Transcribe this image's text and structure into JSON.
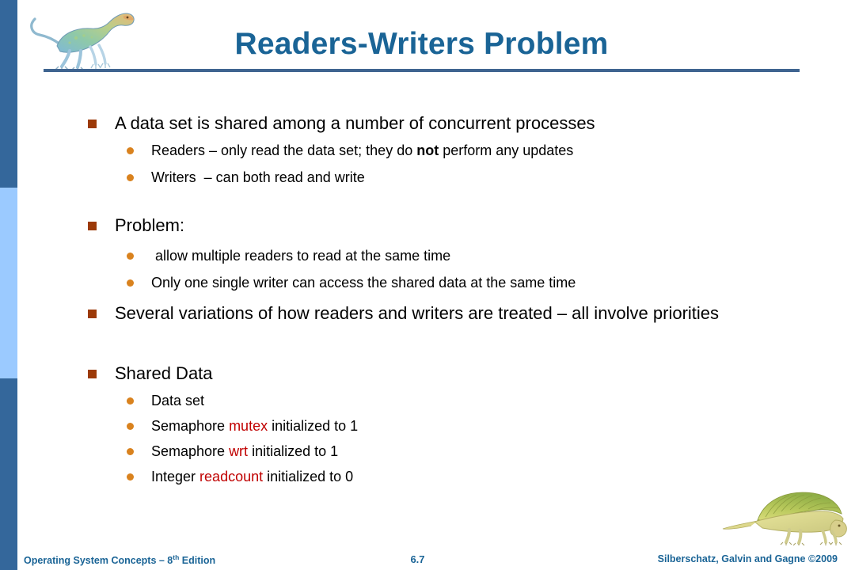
{
  "slide": {
    "title": "Readers-Writers Problem",
    "accent_color": "#1a6496",
    "rule_color": "#3f6490",
    "bullet_l1_color": "#9c3a08",
    "bullet_l2_color": "#d9821e",
    "highlight_color": "#c00000",
    "sidebar": {
      "band_dark_color": "#34679b",
      "band_light_color": "#9bcaff"
    }
  },
  "content": {
    "b1": "A data set is shared among a number of concurrent processes",
    "b1s1_a": "Readers – only read the data set; they do ",
    "b1s1_b": "not",
    "b1s1_c": " perform any updates",
    "b1s2": "Writers  – can both read and write",
    "b2": "Problem:",
    "b2s1": " allow multiple readers to read at the same time",
    "b2s2": "Only one single writer can access the shared data at the same time",
    "b3": "Several variations of how readers and writers are treated – all involve priorities",
    "b4": "Shared Data",
    "b4s1": "Data set",
    "b4s2_a": "Semaphore ",
    "b4s2_b": "mutex",
    "b4s2_c": " initialized to 1",
    "b4s3_a": "Semaphore ",
    "b4s3_b": "wrt",
    "b4s3_c": " initialized to 1",
    "b4s4_a": "Integer ",
    "b4s4_b": "readcount",
    "b4s4_c": " initialized to 0"
  },
  "footer": {
    "left_pre": "Operating System Concepts – 8",
    "left_sup": "th",
    "left_post": " Edition",
    "page": "6.7",
    "right": "Silberschatz, Galvin and Gagne ©2009"
  },
  "icons": {
    "dino_top": "dinosaur-illustration",
    "dino_bottom": "dimetrodon-illustration"
  }
}
